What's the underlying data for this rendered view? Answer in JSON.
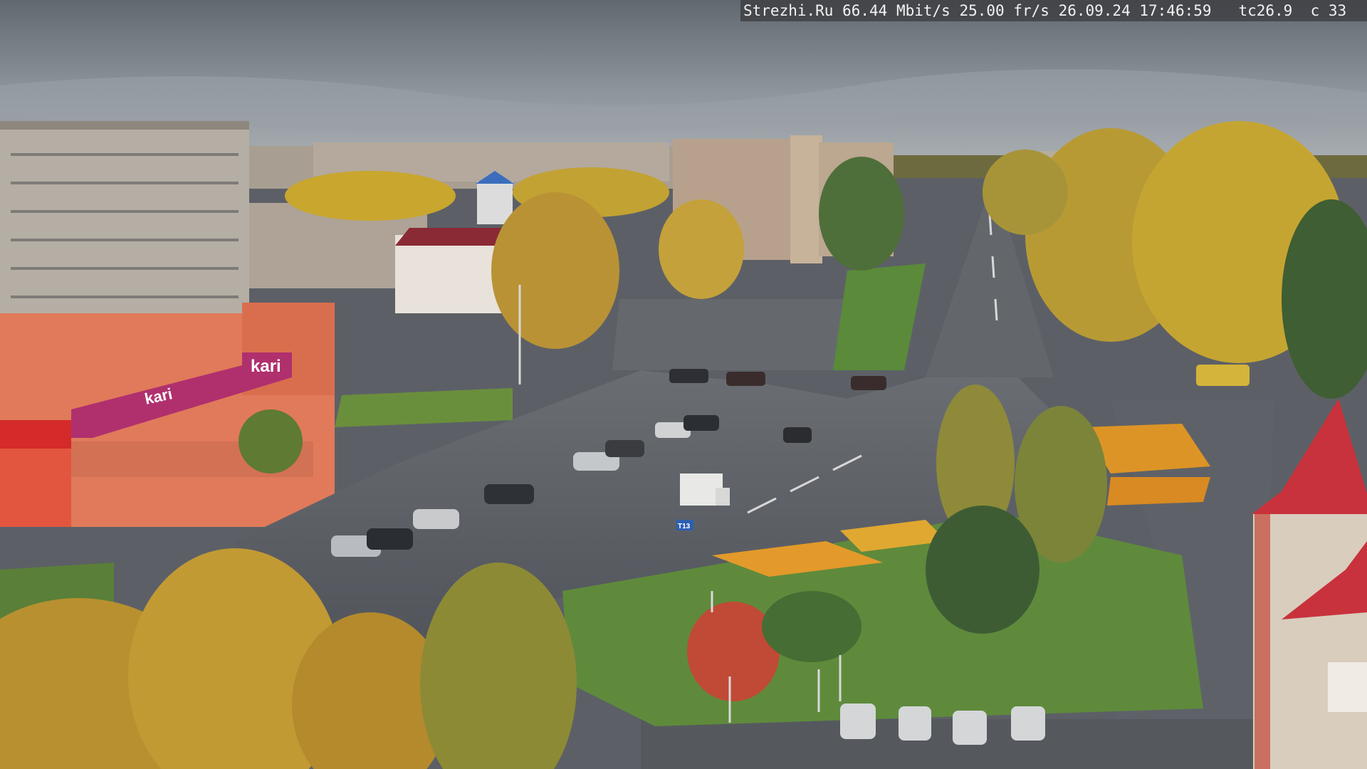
{
  "overlay": {
    "site": "Strezhi.Ru",
    "bitrate": "66.44 Mbit/s",
    "framerate": "25.00 fr/s",
    "date": "26.09.24",
    "time": "17:46:59",
    "temp": "tc26.9",
    "channel": "c 33"
  },
  "signs": {
    "store_brand": "kari",
    "store_side_brand": "kari",
    "road_sign": "T13"
  },
  "colors": {
    "sky": "#7d848c",
    "road": "#5a5e63",
    "grass": "#5f8a3c",
    "autumn_foliage": "#c8a230",
    "store_facade": "#e07a5a",
    "store_banner": "#b0306e",
    "tower_roof": "#c8323c"
  }
}
